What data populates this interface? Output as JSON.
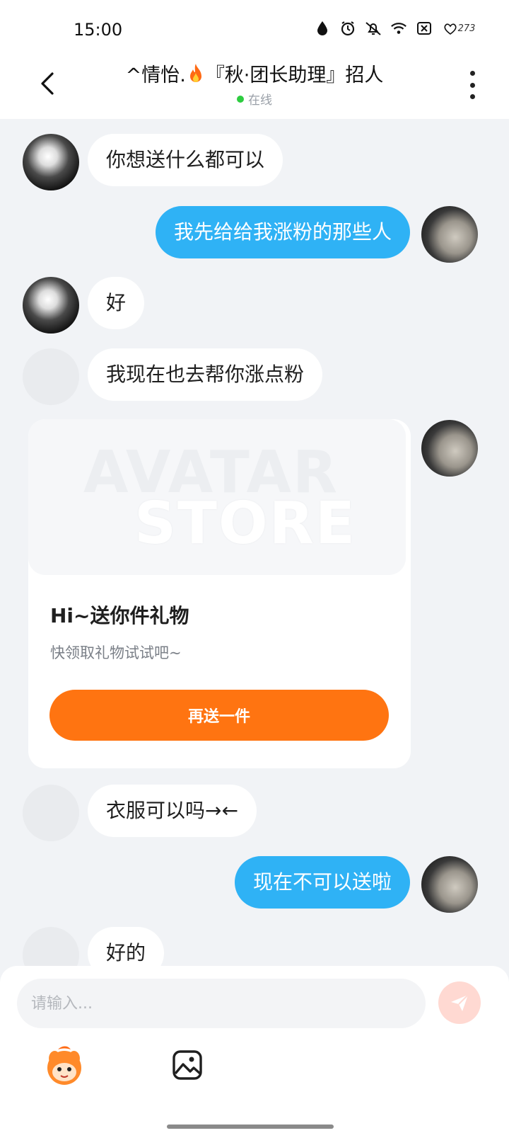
{
  "status_bar": {
    "time": "15:00",
    "battery": "273"
  },
  "header": {
    "title_left": "^情怡.",
    "title_right": "『秋·团长助理』招人",
    "status": "在线"
  },
  "messages": [
    {
      "side": "left",
      "text": "你想送什么都可以"
    },
    {
      "side": "right",
      "text": "我先给给我涨粉的那些人"
    },
    {
      "side": "left",
      "text": "好"
    },
    {
      "side": "left",
      "text": "我现在也去帮你涨点粉"
    },
    {
      "side": "left",
      "text": "衣服可以吗→←"
    },
    {
      "side": "right",
      "text": "现在不可以送啦"
    },
    {
      "side": "left",
      "text": "好的"
    }
  ],
  "gift_card": {
    "watermark_line1": "AVATAR",
    "watermark_line2": "STORE",
    "title": "Hi~送你件礼物",
    "subtitle": "快领取礼物试试吧~",
    "button": "再送一件"
  },
  "input": {
    "placeholder": "请输入..."
  },
  "colors": {
    "accent_blue": "#2fb2f5",
    "accent_orange": "#ff7411",
    "background": "#f1f3f6",
    "online": "#2ecc40"
  },
  "icons": [
    "back-arrow-icon",
    "more-vertical-icon",
    "flame-icon",
    "send-icon",
    "mascot-icon",
    "image-icon"
  ]
}
